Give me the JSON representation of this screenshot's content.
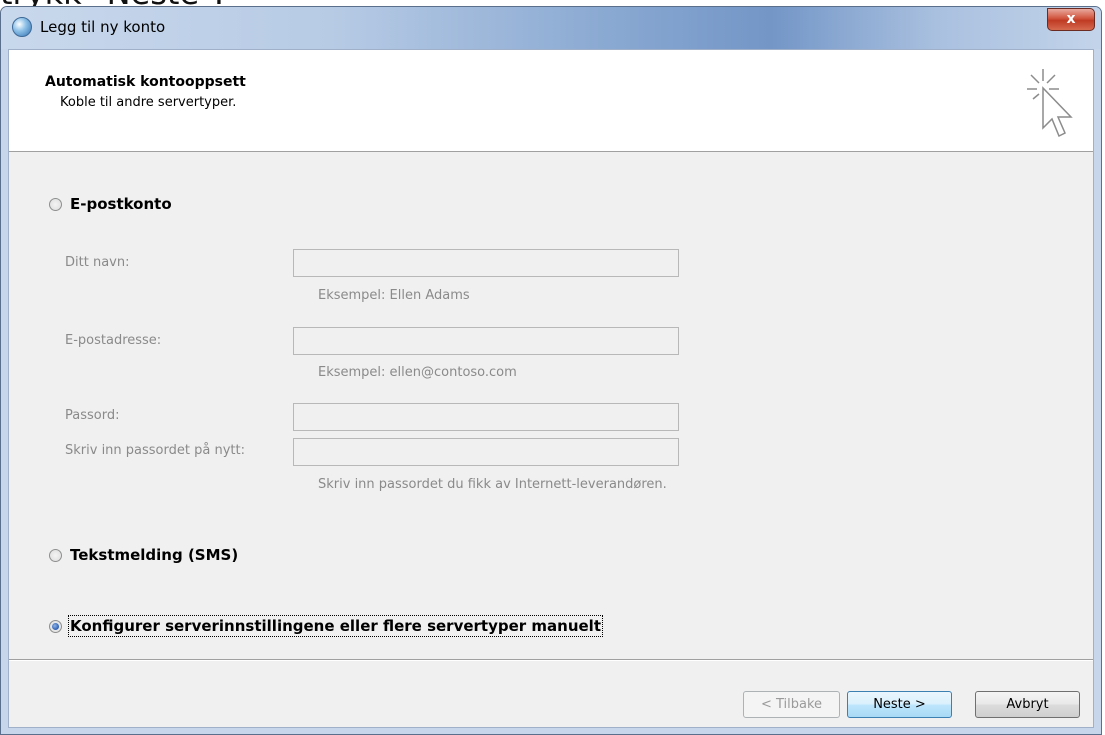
{
  "top_crop_text": "trykk \"Neste\".",
  "window": {
    "title": "Legg til ny konto",
    "close_glyph": "x"
  },
  "header": {
    "title": "Automatisk kontooppsett",
    "subtitle": "Koble til andre servertyper.",
    "icon": "cursor-click-icon"
  },
  "options": {
    "email_account": {
      "label": "E-postkonto",
      "checked": false
    },
    "sms": {
      "label": "Tekstmelding (SMS)",
      "checked": false
    },
    "manual": {
      "label": "Konfigurer serverinnstillingene eller flere servertyper manuelt",
      "checked": true
    }
  },
  "fields": {
    "name": {
      "label": "Ditt navn:",
      "value": "",
      "hint": "Eksempel: Ellen Adams"
    },
    "email": {
      "label": "E-postadresse:",
      "value": "",
      "hint": "Eksempel: ellen@contoso.com"
    },
    "password": {
      "label": "Passord:",
      "value": ""
    },
    "password_confirm": {
      "label": "Skriv inn passordet på nytt:",
      "value": "",
      "hint": "Skriv inn passordet du fikk av Internett-leverandøren."
    }
  },
  "buttons": {
    "back": "< Tilbake",
    "next": "Neste >",
    "cancel": "Avbryt"
  },
  "colors": {
    "default_button_border": "#3c7fb1",
    "close_button": "#c03a23",
    "disabled_text": "#8a8a8a"
  }
}
